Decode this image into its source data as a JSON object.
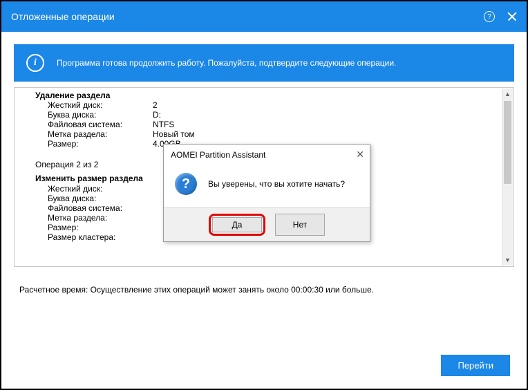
{
  "titlebar": {
    "title": "Отложенные операции"
  },
  "banner": {
    "text": "Программа готова продолжить работу. Пожалуйста, подтвердите следующие операции."
  },
  "op1": {
    "title": "Удаление раздела",
    "hdd_label": "Жесткий диск:",
    "hdd_val": "2",
    "letter_label": "Буква диска:",
    "letter_val": "D:",
    "fs_label": "Файловая система:",
    "fs_val": "NTFS",
    "volname_label": "Метка раздела:",
    "volname_val": "Новый том",
    "size_label": "Размер:",
    "size_val": "4.00GB"
  },
  "op2_header": "Операция 2 из 2",
  "op2": {
    "title": "Изменить размер раздела",
    "hdd_label": "Жесткий диск:",
    "letter_label": "Буква диска:",
    "fs_label": "Файловая система:",
    "volname_label": "Метка раздела:",
    "size_label": "Размер:",
    "cluster_label": "Размер кластера:"
  },
  "estimate": "Расчетное время: Осуществление этих операций может занять около 00:00:30 или больше.",
  "footer": {
    "go": "Перейти"
  },
  "modal": {
    "title": "AOMEI Partition Assistant",
    "message": "Вы уверены, что вы хотите начать?",
    "yes": "Да",
    "no": "Нет"
  }
}
